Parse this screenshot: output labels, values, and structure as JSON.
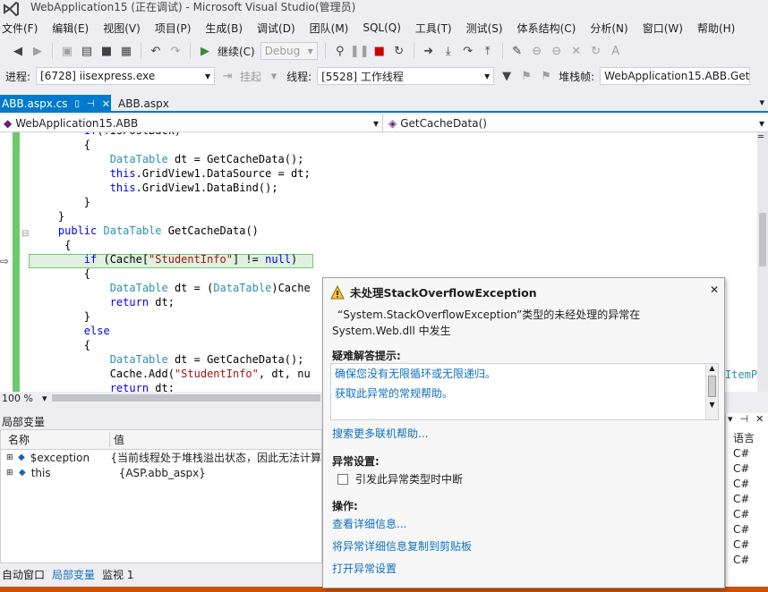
{
  "window": {
    "title": "WebApplication15 (正在调试) - Microsoft Visual Studio(管理员)"
  },
  "menu": [
    "文件(F)",
    "编辑(E)",
    "视图(V)",
    "项目(P)",
    "生成(B)",
    "调试(D)",
    "团队(M)",
    "SQL(Q)",
    "工具(T)",
    "测试(S)",
    "体系结构(C)",
    "分析(N)",
    "窗口(W)",
    "帮助(H)"
  ],
  "toolbar": {
    "continue_label": "继续(C)",
    "config": "Debug"
  },
  "debugbar": {
    "process_label": "进程:",
    "process_value": "[6728] iisexpress.exe",
    "suspend_label": "挂起",
    "thread_label": "线程:",
    "thread_value": "[5528] 工作线程",
    "stackframe_label": "堆栈帧:",
    "stackframe_value": "WebApplication15.ABB.GetCa"
  },
  "tabs": {
    "active": "ABB.aspx.cs",
    "other": "ABB.aspx"
  },
  "nav": {
    "type": "WebApplication15.ABB",
    "member": "GetCacheData()"
  },
  "code": [
    {
      "indent": "        ",
      "parts": [
        [
          "kw",
          "if"
        ],
        [
          "",
          "(!IsPostBack)"
        ]
      ]
    },
    {
      "indent": "        ",
      "parts": [
        [
          "",
          "{"
        ]
      ]
    },
    {
      "indent": "            ",
      "parts": [
        [
          "ty",
          "DataTable"
        ],
        [
          "",
          " dt = GetCacheData();"
        ]
      ]
    },
    {
      "indent": "            ",
      "parts": [
        [
          "kw",
          "this"
        ],
        [
          "",
          ".GridView1.DataSource = dt;"
        ]
      ]
    },
    {
      "indent": "            ",
      "parts": [
        [
          "kw",
          "this"
        ],
        [
          "",
          ".GridView1.DataBind();"
        ]
      ]
    },
    {
      "indent": "        ",
      "parts": [
        [
          "",
          "}"
        ]
      ]
    },
    {
      "indent": "    ",
      "parts": [
        [
          "",
          "}"
        ]
      ]
    },
    {
      "indent": "    ",
      "parts": [
        [
          "kw",
          "public"
        ],
        [
          "",
          " "
        ],
        [
          "ty",
          "DataTable"
        ],
        [
          "",
          " GetCacheData()"
        ]
      ]
    },
    {
      "indent": "     ",
      "parts": [
        [
          "",
          "{"
        ]
      ]
    },
    {
      "indent": "        ",
      "parts": [
        [
          "kw",
          "if"
        ],
        [
          "",
          " (Cache["
        ],
        [
          "st",
          "\"StudentInfo\""
        ],
        [
          "",
          "] != "
        ],
        [
          "kw",
          "null"
        ],
        [
          "",
          ")"
        ]
      ]
    },
    {
      "indent": "        ",
      "parts": [
        [
          "",
          "{"
        ]
      ]
    },
    {
      "indent": "            ",
      "parts": [
        [
          "ty",
          "DataTable"
        ],
        [
          "",
          " dt = ("
        ],
        [
          "ty",
          "DataTable"
        ],
        [
          "",
          ")Cache"
        ]
      ]
    },
    {
      "indent": "            ",
      "parts": [
        [
          "kw",
          "return"
        ],
        [
          "",
          " dt;"
        ]
      ]
    },
    {
      "indent": "        ",
      "parts": [
        [
          "",
          "}"
        ]
      ]
    },
    {
      "indent": "        ",
      "parts": [
        [
          "kw",
          "else"
        ]
      ]
    },
    {
      "indent": "        ",
      "parts": [
        [
          "",
          "{"
        ]
      ]
    },
    {
      "indent": "            ",
      "parts": [
        [
          "ty",
          "DataTable"
        ],
        [
          "",
          " dt = GetCacheData();"
        ]
      ]
    },
    {
      "indent": "            ",
      "parts": [
        [
          "",
          "Cache.Add("
        ],
        [
          "st",
          "\"StudentInfo\""
        ],
        [
          "",
          ", dt, nu"
        ]
      ]
    },
    {
      "indent": "            ",
      "parts": [
        [
          "kw",
          "return"
        ],
        [
          "",
          " dt;"
        ]
      ]
    }
  ],
  "editor": {
    "zoom": "100 %",
    "right_fragment": "ItemP"
  },
  "locals": {
    "title": "局部变量",
    "col_name": "名称",
    "col_value": "值",
    "rows": [
      {
        "name": "$exception",
        "value": "{当前线程处于堆栈溢出状态，因此无法计算"
      },
      {
        "name": "this",
        "value": "{ASP.abb_aspx}"
      }
    ]
  },
  "bottom_tabs": [
    "自动窗口",
    "局部变量",
    "监视 1"
  ],
  "right_pane": {
    "header": "语言",
    "rows": [
      "C#",
      "C#",
      "C#",
      "C#",
      "C#",
      "C#",
      "C#",
      "C#"
    ]
  },
  "exception": {
    "title": "未处理StackOverflowException",
    "message_line1": "“System.StackOverflowException”类型的未经处理的异常在",
    "message_line2": "System.Web.dll 中发生",
    "tips_header": "疑难解答提示:",
    "tips": [
      "确保您没有无限循环或无限递归。",
      "获取此异常的常规帮助。"
    ],
    "search_link": "搜索更多联机帮助...",
    "settings_header": "异常设置:",
    "break_checkbox": "引发此异常类型时中断",
    "actions_header": "操作:",
    "actions": [
      "查看详细信息...",
      "将异常详细信息复制到剪贴板",
      "打开异常设置"
    ]
  }
}
